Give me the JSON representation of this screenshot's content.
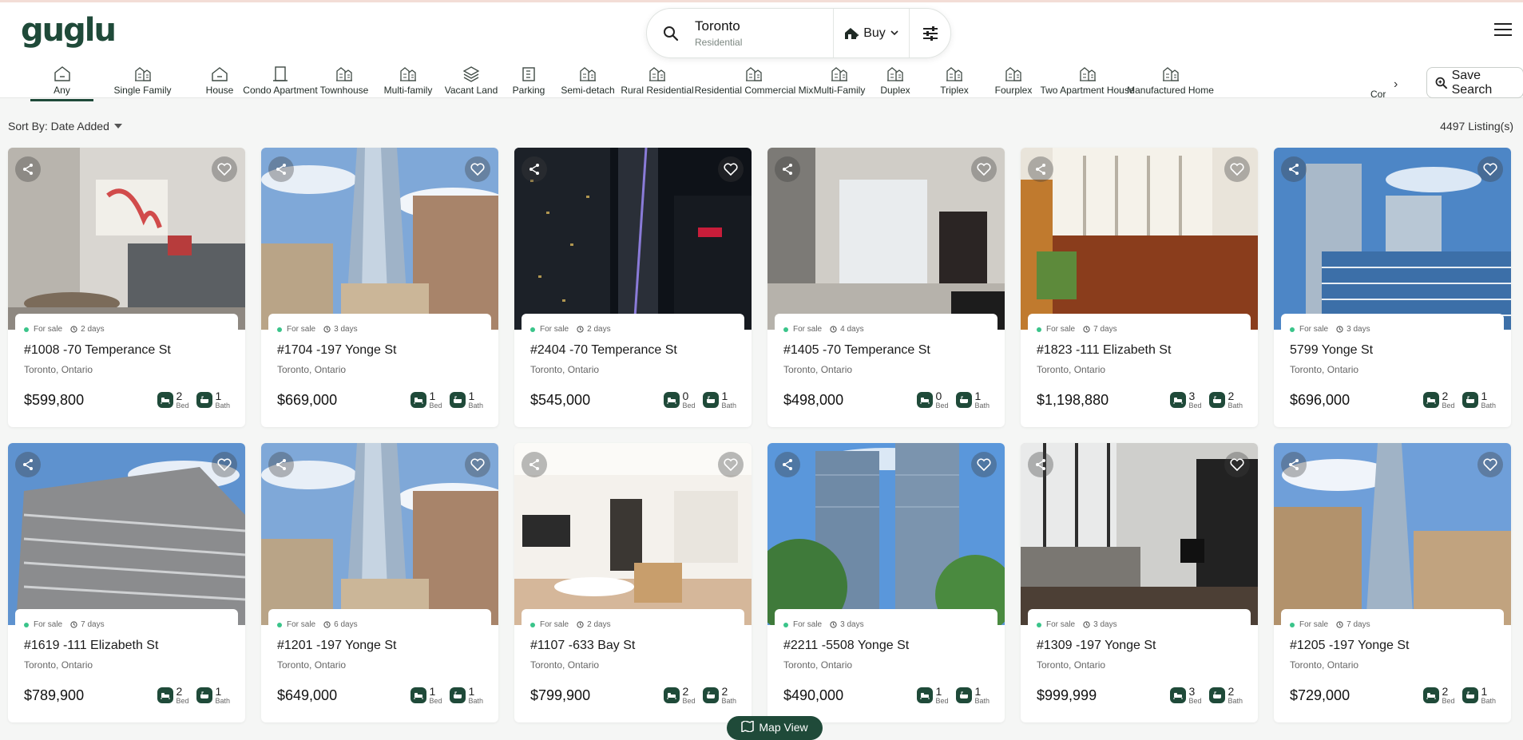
{
  "brand": {
    "logo_text": "guglu",
    "accent": "#1f4a39"
  },
  "search": {
    "city": "Toronto",
    "subtitle": "Residential",
    "mode_label": "Buy",
    "filter_icon": "sliders-icon"
  },
  "categories": [
    {
      "label": "Any",
      "icon": "house-outline-icon",
      "active": true
    },
    {
      "label": "Single Family",
      "icon": "building-icon"
    },
    {
      "label": "House",
      "icon": "house-icon"
    },
    {
      "label": "Condo Apartment",
      "icon": "door-icon"
    },
    {
      "label": "Townhouse",
      "icon": "townhouse-icon"
    },
    {
      "label": "Multi-family",
      "icon": "apartment-icon"
    },
    {
      "label": "Vacant Land",
      "icon": "layers-icon"
    },
    {
      "label": "Parking",
      "icon": "parking-icon"
    },
    {
      "label": "Semi-detach",
      "icon": "semi-detached-icon"
    },
    {
      "label": "Rural Residential",
      "icon": "rural-icon"
    },
    {
      "label": "Residential Commercial Mix",
      "icon": "mixed-use-icon"
    },
    {
      "label": "Multi-Family",
      "icon": "apartment-icon"
    },
    {
      "label": "Duplex",
      "icon": "duplex-icon"
    },
    {
      "label": "Triplex",
      "icon": "triplex-icon"
    },
    {
      "label": "Fourplex",
      "icon": "fourplex-icon"
    },
    {
      "label": "Two Apartment House",
      "icon": "two-apartment-icon"
    },
    {
      "label": "Manufactured Home",
      "icon": "manufactured-icon"
    }
  ],
  "categories_clipped": "Cor",
  "save_search_label": "Save Search",
  "sort_label": "Sort By: Date Added",
  "listing_count": "4497 Listing(s)",
  "map_view_label": "Map View",
  "bed_label": "Bed",
  "bath_label": "Bath",
  "listings": [
    {
      "status": "For sale",
      "age": "2 days",
      "address": "#1008 -70 Temperance St",
      "city": "Toronto, Ontario",
      "price": "$599,800",
      "beds": "2",
      "baths": "1",
      "photo": "living-room"
    },
    {
      "status": "For sale",
      "age": "3 days",
      "address": "#1704 -197 Yonge St",
      "city": "Toronto, Ontario",
      "price": "$669,000",
      "beds": "1",
      "baths": "1",
      "photo": "tower"
    },
    {
      "status": "For sale",
      "age": "2 days",
      "address": "#2404 -70 Temperance St",
      "city": "Toronto, Ontario",
      "price": "$545,000",
      "beds": "0",
      "baths": "1",
      "photo": "night-towers"
    },
    {
      "status": "For sale",
      "age": "4 days",
      "address": "#1405 -70 Temperance St",
      "city": "Toronto, Ontario",
      "price": "$498,000",
      "beds": "0",
      "baths": "1",
      "photo": "interior"
    },
    {
      "status": "For sale",
      "age": "7 days",
      "address": "#1823 -111 Elizabeth St",
      "city": "Toronto, Ontario",
      "price": "$1,198,880",
      "beds": "3",
      "baths": "2",
      "photo": "wood-floor"
    },
    {
      "status": "For sale",
      "age": "3 days",
      "address": "5799 Yonge St",
      "city": "Toronto, Ontario",
      "price": "$696,000",
      "beds": "2",
      "baths": "1",
      "photo": "blue-tower"
    },
    {
      "status": "For sale",
      "age": "7 days",
      "address": "#1619 -111 Elizabeth St",
      "city": "Toronto, Ontario",
      "price": "$789,900",
      "beds": "2",
      "baths": "1",
      "photo": "gray-building"
    },
    {
      "status": "For sale",
      "age": "6 days",
      "address": "#1201 -197 Yonge St",
      "city": "Toronto, Ontario",
      "price": "$649,000",
      "beds": "1",
      "baths": "1",
      "photo": "tower"
    },
    {
      "status": "For sale",
      "age": "2 days",
      "address": "#1107 -633 Bay St",
      "city": "Toronto, Ontario",
      "price": "$799,900",
      "beds": "2",
      "baths": "2",
      "photo": "bright-living"
    },
    {
      "status": "For sale",
      "age": "3 days",
      "address": "#2211 -5508 Yonge St",
      "city": "Toronto, Ontario",
      "price": "$490,000",
      "beds": "1",
      "baths": "1",
      "photo": "twin-towers"
    },
    {
      "status": "For sale",
      "age": "3 days",
      "address": "#1309 -197 Yonge St",
      "city": "Toronto, Ontario",
      "price": "$999,999",
      "beds": "3",
      "baths": "2",
      "photo": "gray-living"
    },
    {
      "status": "For sale",
      "age": "7 days",
      "address": "#1205 -197 Yonge St",
      "city": "Toronto, Ontario",
      "price": "$729,000",
      "beds": "2",
      "baths": "1",
      "photo": "tower-street"
    }
  ]
}
